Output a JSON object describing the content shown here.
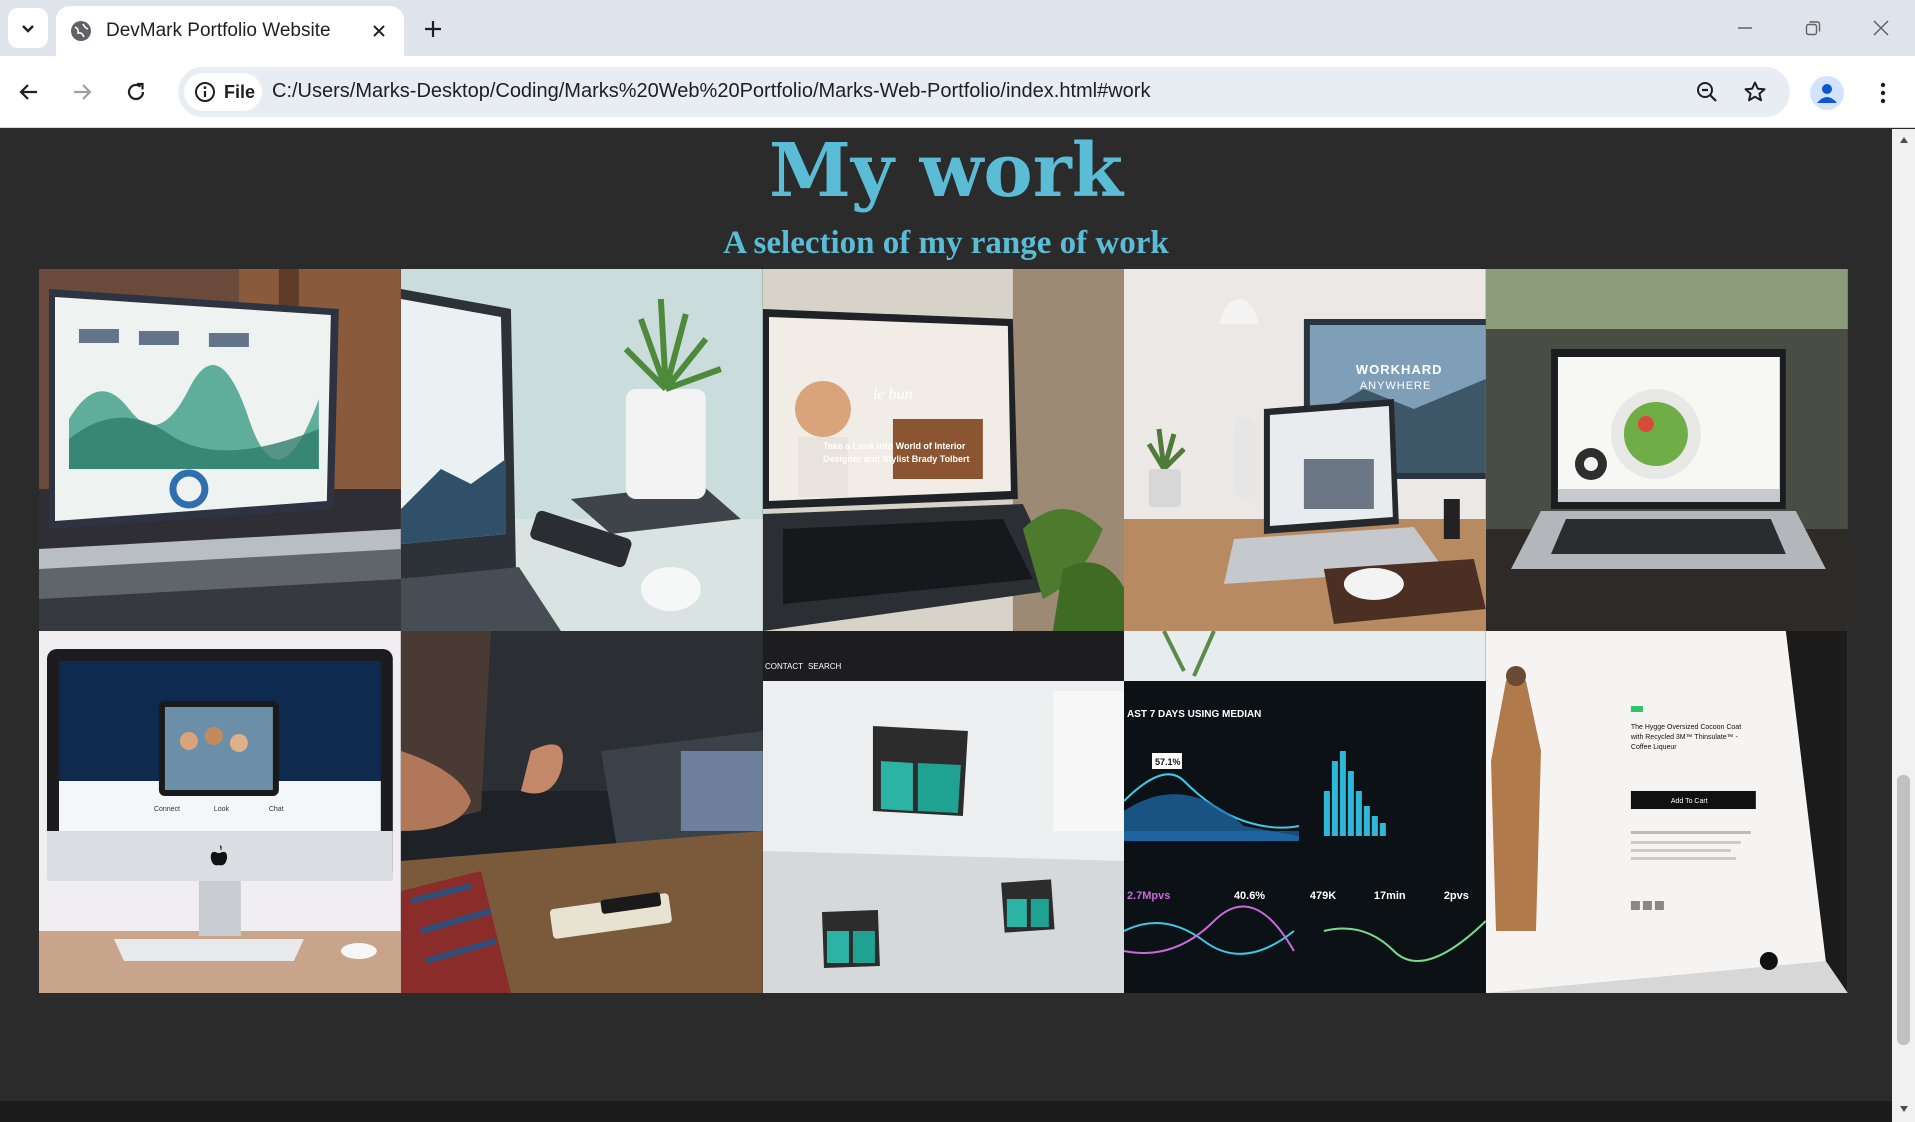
{
  "browser": {
    "tab_title": "DevMark Portfolio Website",
    "chip_label": "File",
    "url": "C:/Users/Marks-Desktop/Coding/Marks%20Web%20Portfolio/Marks-Web-Portfolio/index.html#work",
    "icons": [
      "tab-search-icon",
      "globe-icon",
      "close-icon",
      "plus-icon",
      "minimize-icon",
      "restore-icon",
      "window-close-icon",
      "back-icon",
      "forward-icon",
      "reload-icon",
      "info-icon",
      "zoom-icon",
      "star-icon",
      "profile-icon",
      "more-icon"
    ]
  },
  "page": {
    "heading": "My work",
    "subheading": "A selection of my range of work",
    "colors": {
      "accent": "#5bbcd6",
      "background": "#2b2b2b"
    }
  },
  "gallery": {
    "tiles": [
      {
        "name": "laptop-dashboard"
      },
      {
        "name": "laptop-plant"
      },
      {
        "name": "laptop-interior-website",
        "text": [
          "le bun",
          "Take a Look into World of Interior",
          "Designer and Stylist Brady Tolbert"
        ]
      },
      {
        "name": "workhard-desk",
        "text": [
          "WORKHARD",
          "ANYWHERE"
        ]
      },
      {
        "name": "laptop-food-site"
      },
      {
        "name": "imac-website",
        "text": [
          "Connect",
          "Look",
          "Chat"
        ]
      },
      {
        "name": "meeting-hands"
      },
      {
        "name": "logo-mockup",
        "text": [
          "CONTACT",
          "SEARCH"
        ]
      },
      {
        "name": "analytics-dashboard",
        "text": [
          "AST 7 DAYS USING MEDIAN",
          "57.1%",
          "2.7Mpvs",
          "40.6%",
          "479K",
          "17min",
          "2pvs"
        ]
      },
      {
        "name": "ecommerce-coat",
        "text": [
          "The Hygge Oversized Cocoon Coat with Recycled 3M™ Thinsulate™ - Coffee Liqueur",
          "Add To Cart"
        ]
      }
    ]
  }
}
